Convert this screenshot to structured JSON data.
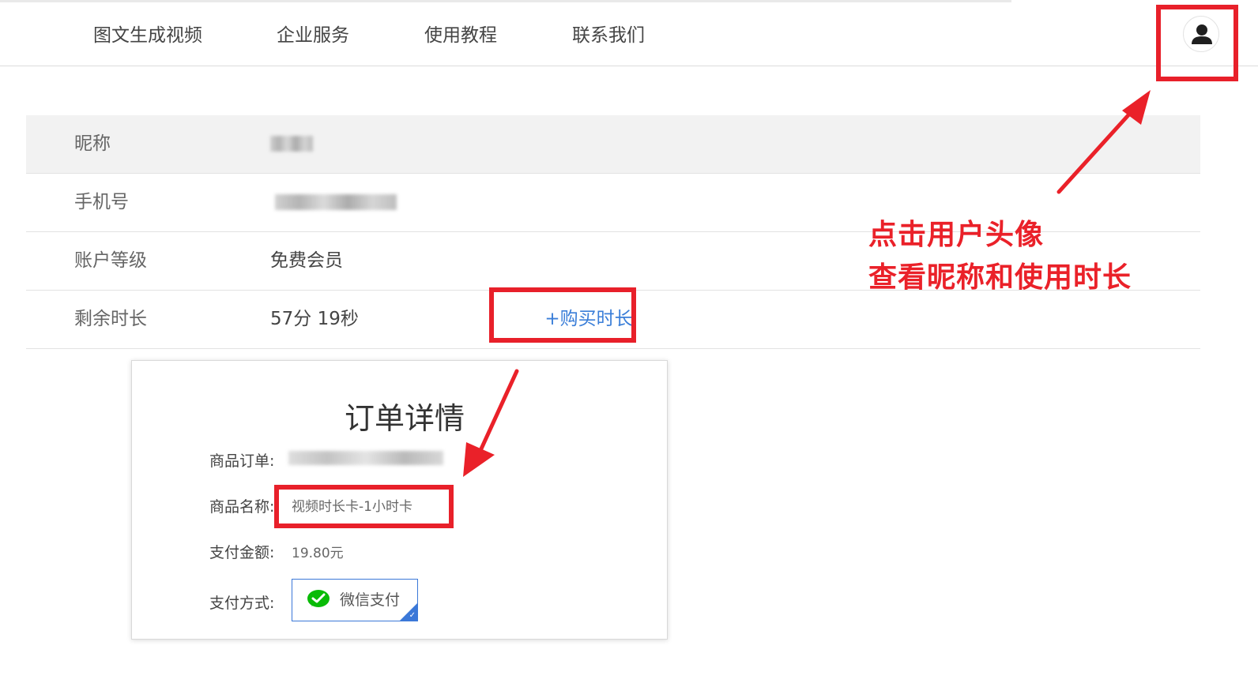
{
  "nav": {
    "items": [
      "图文生成视频",
      "企业服务",
      "使用教程",
      "联系我们"
    ],
    "avatar_icon": "user-avatar-icon"
  },
  "profile": {
    "rows": [
      {
        "label": "昵称",
        "value": ""
      },
      {
        "label": "手机号",
        "value": ""
      },
      {
        "label": "账户等级",
        "value": "免费会员"
      },
      {
        "label": "剩余时长",
        "value": "57分 19秒"
      }
    ],
    "buy_label": "+购买时长"
  },
  "annotation": {
    "line1": "点击用户头像",
    "line2": "查看昵称和使用时长"
  },
  "order": {
    "title": "订单详情",
    "order_no_label": "商品订单:",
    "product_label": "商品名称:",
    "product_value": "视频时长卡-1小时卡",
    "amount_label": "支付金额:",
    "amount_value": "19.80元",
    "method_label": "支付方式:",
    "method_value": "微信支付",
    "method_icon": "wechat-pay-icon"
  },
  "colors": {
    "highlight_red": "#e8202a",
    "link_blue": "#3a7ed8",
    "wechat_green": "#09bb07"
  }
}
